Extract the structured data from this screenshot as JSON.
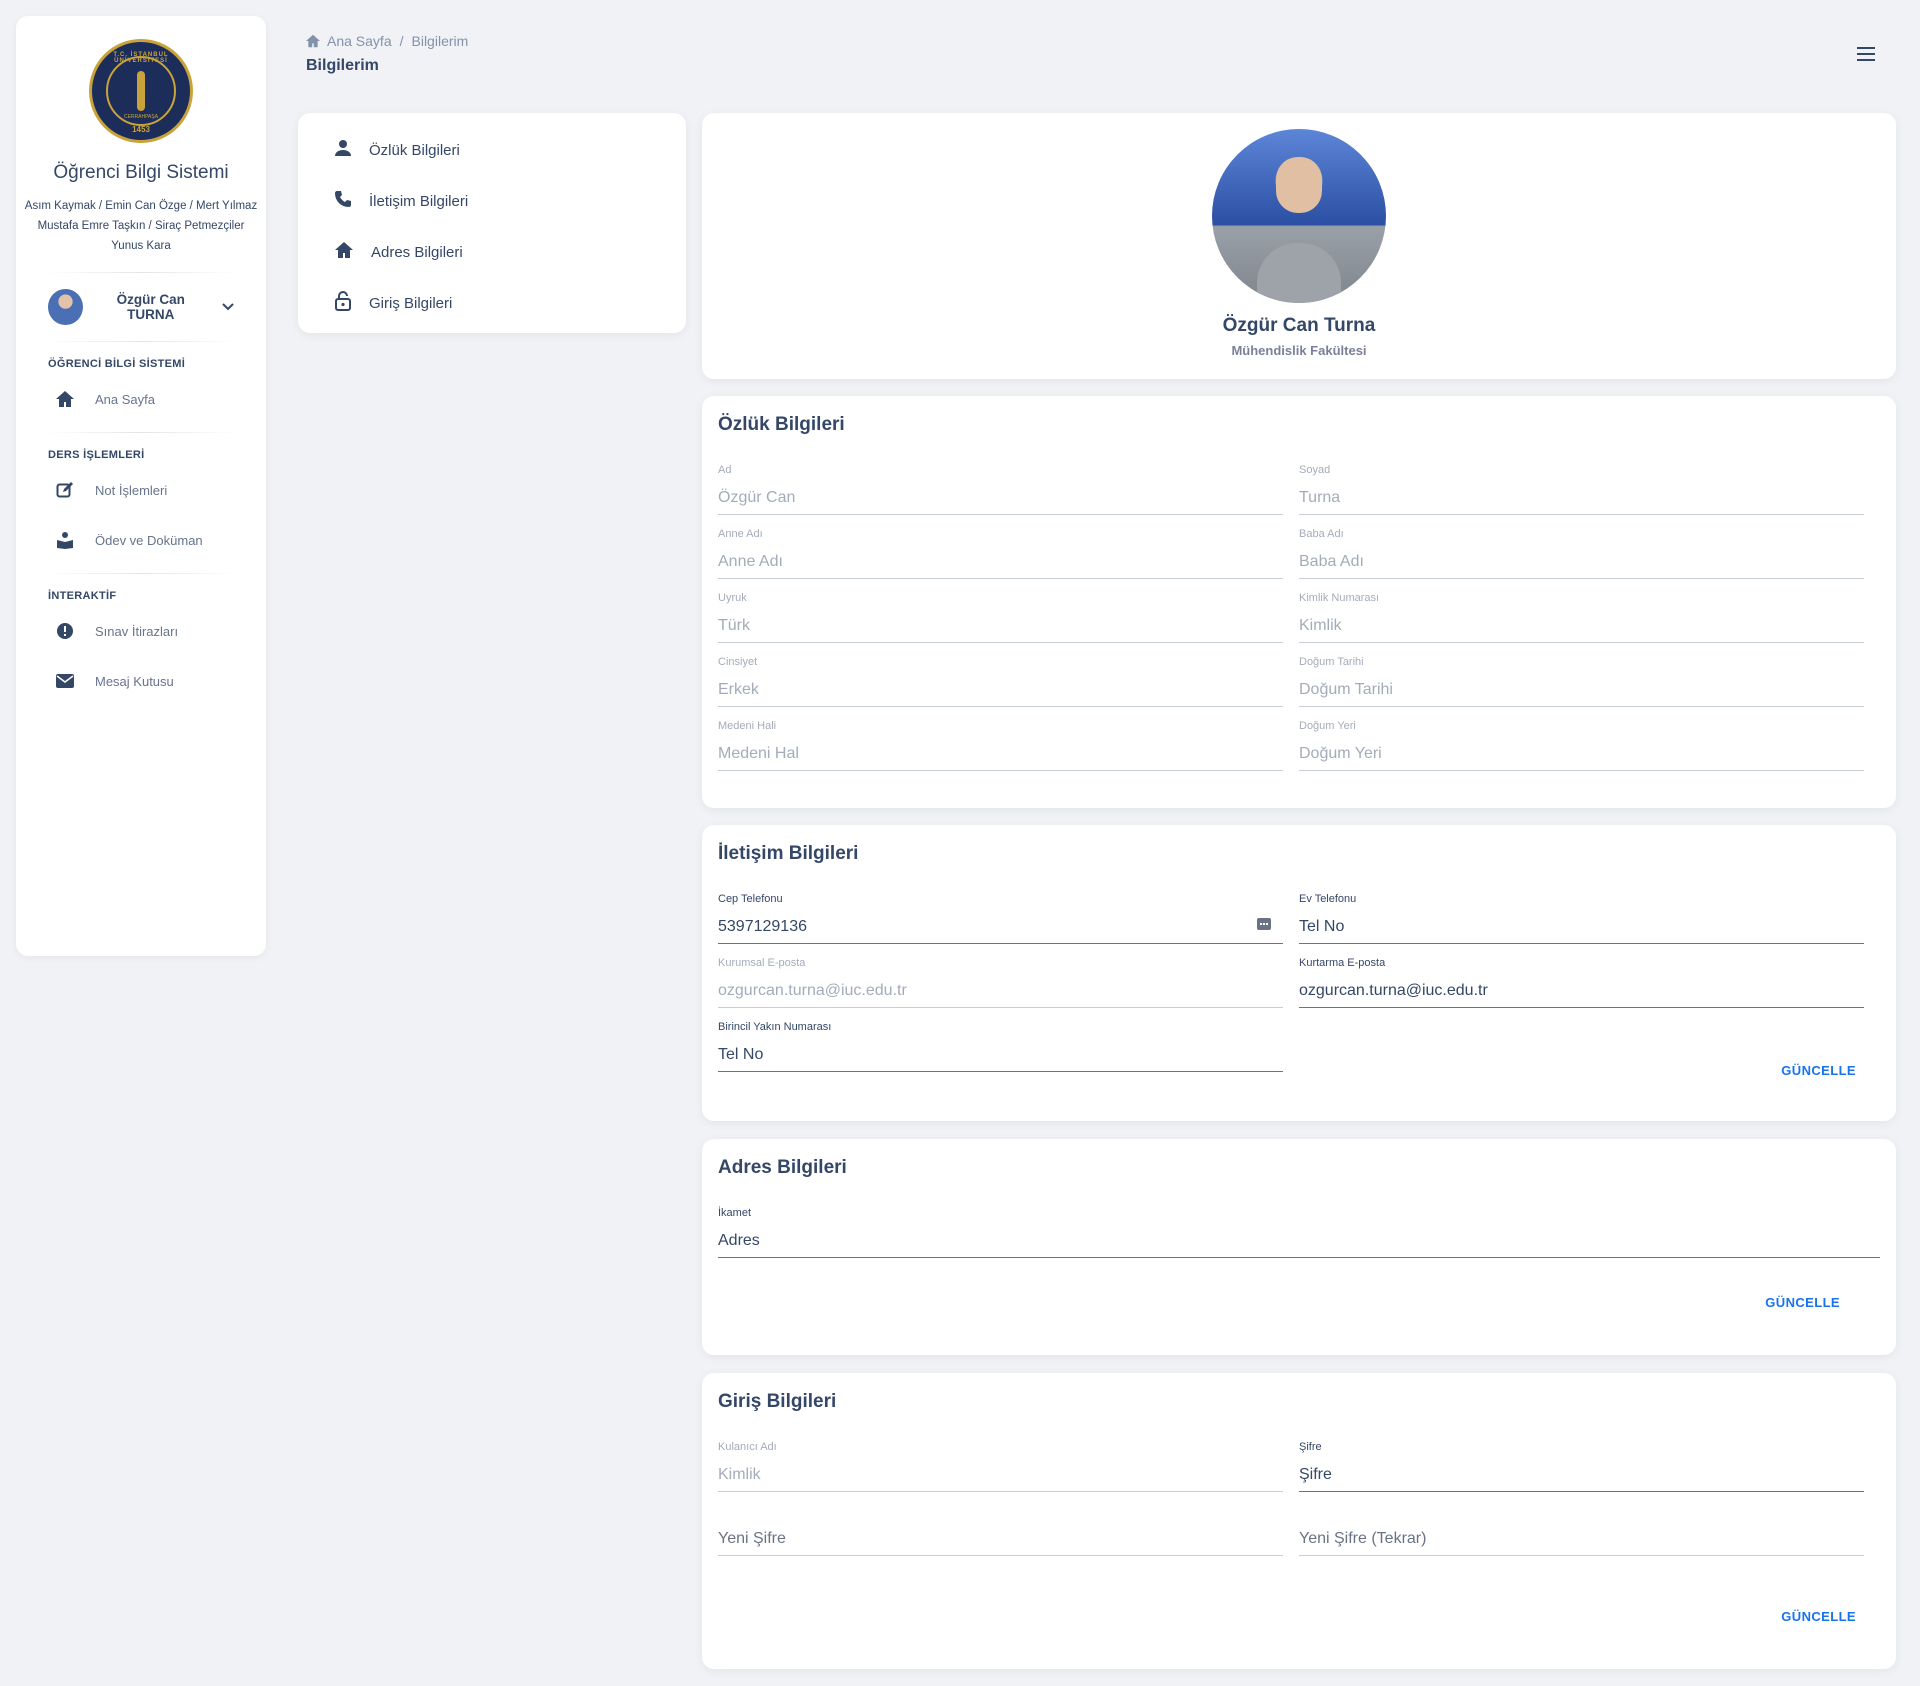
{
  "sidebar": {
    "logo": {
      "top_text": "T.C. İSTANBUL ÜNİVERSİTESİ",
      "year": "1453",
      "mid_text": "CERRAHPAŞA"
    },
    "app_title": "Öğrenci Bilgi Sistemi",
    "authors": [
      "Asım Kaymak / Emin Can Özge / Mert Yılmaz",
      "Mustafa Emre Taşkın / Siraç Petmezçiler",
      "Yunus Kara"
    ],
    "user_name": "Özgür Can TURNA",
    "sections": [
      {
        "title": "ÖĞRENCİ BİLGİ SİSTEMİ",
        "items": [
          {
            "label": "Ana Sayfa",
            "icon": "home-icon"
          }
        ]
      },
      {
        "title": "DERS İŞLEMLERİ",
        "items": [
          {
            "label": "Not İşlemleri",
            "icon": "edit-icon"
          },
          {
            "label": "Ödev ve Doküman",
            "icon": "book-reader-icon"
          }
        ]
      },
      {
        "title": "İNTERAKTİF",
        "items": [
          {
            "label": "Sınav İtirazları",
            "icon": "alert-icon"
          },
          {
            "label": "Mesaj Kutusu",
            "icon": "mail-icon"
          }
        ]
      }
    ]
  },
  "header": {
    "breadcrumb": {
      "home": "Ana Sayfa",
      "current": "Bilgilerim",
      "separator": "/"
    },
    "title": "Bilgilerim"
  },
  "menu": [
    {
      "label": "Özlük Bilgileri",
      "icon": "person-icon"
    },
    {
      "label": "İletişim Bilgileri",
      "icon": "phone-icon"
    },
    {
      "label": "Adres Bilgileri",
      "icon": "home-icon"
    },
    {
      "label": "Giriş Bilgileri",
      "icon": "lock-icon"
    }
  ],
  "profile": {
    "name": "Özgür Can Turna",
    "faculty": "Mühendislik Fakültesi"
  },
  "personal": {
    "title": "Özlük Bilgileri",
    "fields": [
      {
        "label": "Ad",
        "value": "Özgür Can"
      },
      {
        "label": "Soyad",
        "value": "Turna"
      },
      {
        "label": "Anne Adı",
        "value": "Anne Adı"
      },
      {
        "label": "Baba Adı",
        "value": "Baba Adı"
      },
      {
        "label": "Uyruk",
        "value": "Türk"
      },
      {
        "label": "Kimlik Numarası",
        "value": "Kimlik"
      },
      {
        "label": "Cinsiyet",
        "value": "Erkek"
      },
      {
        "label": "Doğum Tarihi",
        "value": "Doğum Tarihi"
      },
      {
        "label": "Medeni Hali",
        "value": "Medeni Hal"
      },
      {
        "label": "Doğum Yeri",
        "value": "Doğum Yeri"
      }
    ]
  },
  "contact": {
    "title": "İletişim Bilgileri",
    "fields": [
      {
        "label": "Cep Telefonu",
        "value": "5397129136"
      },
      {
        "label": "Ev Telefonu",
        "value": "Tel No"
      },
      {
        "label": "Kurumsal E-posta",
        "value": "ozgurcan.turna@iuc.edu.tr"
      },
      {
        "label": "Kurtarma E-posta",
        "value": "ozgurcan.turna@iuc.edu.tr"
      },
      {
        "label": "Birincil Yakın Numarası",
        "value": "Tel No"
      }
    ],
    "button": "GÜNCELLE"
  },
  "address": {
    "title": "Adres Bilgileri",
    "field": {
      "label": "İkamet",
      "value": "Adres"
    },
    "button": "GÜNCELLE"
  },
  "login": {
    "title": "Giriş Bilgileri",
    "fields": [
      {
        "label": "Kulanıcı Adı",
        "value": "Kimlik"
      },
      {
        "label": "Şifre",
        "value": "Şifre"
      },
      {
        "label": "",
        "value": "Yeni Şifre"
      },
      {
        "label": "",
        "value": "Yeni Şifre (Tekrar)"
      }
    ],
    "button": "GÜNCELLE"
  },
  "colors": {
    "primary_text": "#344767",
    "link": "#1a73e8",
    "background": "#f0f2f5",
    "logo_gold": "#c9a33a",
    "logo_navy": "#1c2d5a"
  }
}
